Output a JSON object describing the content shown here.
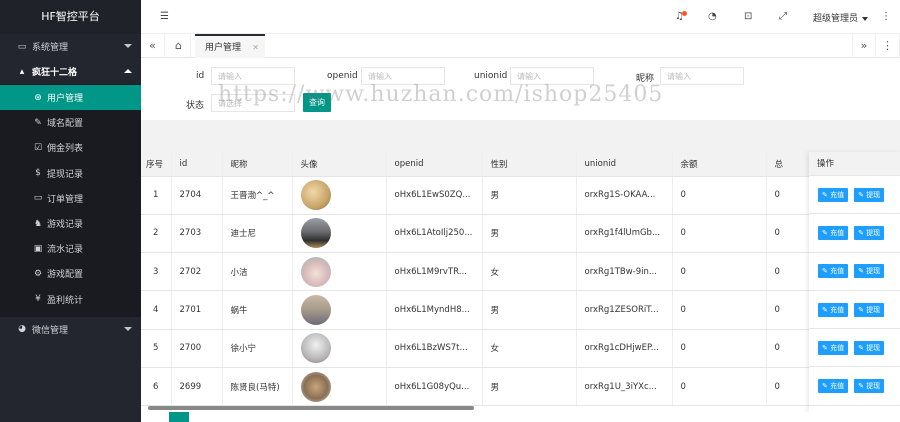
{
  "app": {
    "title": "HF智控平台"
  },
  "sidebar": {
    "groups": [
      {
        "label": "系统管理",
        "icon": "monitor-icon"
      },
      {
        "label": "疯狂十二格",
        "icon": "house-icon"
      }
    ],
    "sub_items": [
      {
        "label": "用户管理",
        "icon": "user-circle-icon",
        "glyph": "⊛"
      },
      {
        "label": "域名配置",
        "icon": "brush-icon",
        "glyph": "✎"
      },
      {
        "label": "佣金列表",
        "icon": "checkbox-icon",
        "glyph": "☑"
      },
      {
        "label": "提现记录",
        "icon": "dollar-icon",
        "glyph": "$"
      },
      {
        "label": "订单管理",
        "icon": "card-icon",
        "glyph": "▭"
      },
      {
        "label": "游戏记录",
        "icon": "chess-icon",
        "glyph": "♞"
      },
      {
        "label": "流水记录",
        "icon": "screen-icon",
        "glyph": "▣"
      },
      {
        "label": "游戏配置",
        "icon": "cogs-icon",
        "glyph": "⚙"
      },
      {
        "label": "盈利统计",
        "icon": "yen-icon",
        "glyph": "¥"
      }
    ],
    "wechat": {
      "label": "微信管理",
      "icon": "wechat-icon"
    }
  },
  "topbar": {
    "user": "超级管理员"
  },
  "tabs": [
    {
      "label": "用户管理"
    }
  ],
  "filter": {
    "id_label": "id",
    "id_placeholder": "请输入",
    "openid_label": "openid",
    "openid_placeholder": "请输入",
    "unionid_label": "unionid",
    "unionid_placeholder": "请输入",
    "nickname_label": "昵称",
    "nickname_placeholder": "请输入",
    "status_label": "状态",
    "status_placeholder": "请选择",
    "search_button": "查询"
  },
  "watermark": "https://www.huzhan.com/ishop25405",
  "table": {
    "columns": [
      "序号",
      "id",
      "昵称",
      "头像",
      "openid",
      "性别",
      "unionid",
      "余额",
      "总"
    ],
    "op_header": "操作",
    "op_buttons": {
      "recharge": "充值",
      "withdraw": "提现"
    },
    "rows": [
      {
        "no": "1",
        "id": "2704",
        "nickname": "王晋渤^_^",
        "avatar": "#c7a46a",
        "openid": "oHx6L1EwS0ZQ...",
        "gender": "男",
        "unionid": "orxRg1S-OKAA...",
        "balance": "0",
        "total": "0"
      },
      {
        "no": "2",
        "id": "2703",
        "nickname": "迪士尼",
        "avatar": "#6c6d70",
        "openid": "oHx6L1AtoIlj250...",
        "gender": "男",
        "unionid": "orxRg1f4lUmGb...",
        "balance": "0",
        "total": "0"
      },
      {
        "no": "3",
        "id": "2702",
        "nickname": "小洁",
        "avatar": "#d6b7b9",
        "openid": "oHx6L1M9rvTR...",
        "gender": "女",
        "unionid": "orxRg1TBw-9in...",
        "balance": "0",
        "total": "0"
      },
      {
        "no": "4",
        "id": "2701",
        "nickname": "蜗牛",
        "avatar": "#a59a8a",
        "openid": "oHx6L1MyndH8...",
        "gender": "男",
        "unionid": "orxRg1ZESORiT...",
        "balance": "0",
        "total": "0"
      },
      {
        "no": "5",
        "id": "2700",
        "nickname": "徐小宁",
        "avatar": "#b8b8b8",
        "openid": "oHx6L1BzWS7t...",
        "gender": "女",
        "unionid": "orxRg1cDHjwEP...",
        "balance": "0",
        "total": "0"
      },
      {
        "no": "6",
        "id": "2699",
        "nickname": "陈贤良(马特)",
        "avatar": "#8a6f55",
        "openid": "oHx6L1G08yQu...",
        "gender": "男",
        "unionid": "orxRg1U_3iYXc...",
        "balance": "0",
        "total": "0"
      }
    ]
  },
  "colors": {
    "sidebar_bg": "#23262e",
    "accent": "#009688",
    "button_blue": "#1e9fff",
    "badge_red": "#ff5722"
  }
}
